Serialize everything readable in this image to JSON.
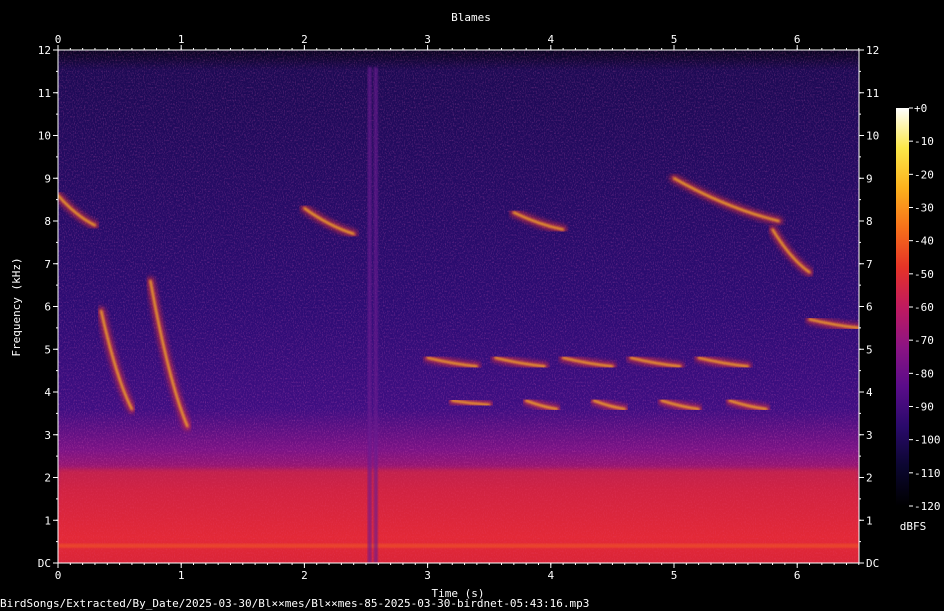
{
  "chart_data": {
    "type": "heatmap",
    "title": "Blames",
    "xlabel": "Time (s)",
    "ylabel": "Frequency (kHz)",
    "xlim": [
      0,
      6.5
    ],
    "ylim": [
      0,
      12
    ],
    "x_ticks": [
      "0",
      "1",
      "2",
      "3",
      "4",
      "5",
      "6"
    ],
    "y_ticks": [
      "DC",
      "1",
      "2",
      "3",
      "4",
      "5",
      "6",
      "7",
      "8",
      "9",
      "10",
      "11",
      "12"
    ],
    "colorbar": {
      "unit": "dBFS",
      "range": [
        -120,
        0
      ],
      "ticks": [
        "+0",
        "-10",
        "-20",
        "-30",
        "-40",
        "-50",
        "-60",
        "-70",
        "-80",
        "-90",
        "-100",
        "-110",
        "-120"
      ]
    },
    "vertical_clicks_s": [
      2.53,
      2.58
    ],
    "noise_floor_band_khz": [
      0,
      2.2
    ],
    "calls": [
      {
        "name": "descending sweep",
        "t": [
          0.35,
          0.6
        ],
        "f": [
          5.9,
          3.6
        ]
      },
      {
        "name": "descending sweep",
        "t": [
          0.75,
          1.05
        ],
        "f": [
          6.6,
          3.2
        ]
      },
      {
        "name": "whistle",
        "t": [
          0.0,
          0.3
        ],
        "f": [
          8.6,
          7.9
        ]
      },
      {
        "name": "slur",
        "t": [
          2.0,
          2.4
        ],
        "f": [
          8.3,
          7.7
        ]
      },
      {
        "name": "slur",
        "t": [
          3.7,
          4.1
        ],
        "f": [
          8.2,
          7.8
        ]
      },
      {
        "name": "repeated note",
        "t": [
          3.2,
          3.5
        ],
        "f": [
          3.8,
          3.7
        ]
      },
      {
        "name": "repeated note",
        "t": [
          3.8,
          4.05
        ],
        "f": [
          3.8,
          3.6
        ]
      },
      {
        "name": "repeated note",
        "t": [
          4.35,
          4.6
        ],
        "f": [
          3.8,
          3.6
        ]
      },
      {
        "name": "repeated note",
        "t": [
          4.9,
          5.2
        ],
        "f": [
          3.8,
          3.6
        ]
      },
      {
        "name": "repeated note",
        "t": [
          5.45,
          5.75
        ],
        "f": [
          3.8,
          3.6
        ]
      },
      {
        "name": "harmonic stack",
        "t": [
          3.0,
          3.4
        ],
        "f": [
          4.8,
          4.6
        ]
      },
      {
        "name": "harmonic stack",
        "t": [
          3.55,
          3.95
        ],
        "f": [
          4.8,
          4.6
        ]
      },
      {
        "name": "harmonic stack",
        "t": [
          4.1,
          4.5
        ],
        "f": [
          4.8,
          4.6
        ]
      },
      {
        "name": "harmonic stack",
        "t": [
          4.65,
          5.05
        ],
        "f": [
          4.8,
          4.6
        ]
      },
      {
        "name": "harmonic stack",
        "t": [
          5.2,
          5.6
        ],
        "f": [
          4.8,
          4.6
        ]
      },
      {
        "name": "descending whistle",
        "t": [
          5.0,
          5.85
        ],
        "f": [
          9.0,
          8.0
        ]
      },
      {
        "name": "descending whistle",
        "t": [
          5.8,
          6.1
        ],
        "f": [
          7.8,
          6.8
        ]
      },
      {
        "name": "trill",
        "t": [
          6.1,
          6.5
        ],
        "f": [
          5.7,
          5.5
        ]
      }
    ]
  },
  "footer": {
    "filepath": "BirdSongs/Extracted/By_Date/2025-03-30/Bl××mes/Bl××mes-85-2025-03-30-birdnet-05:43:16.mp3"
  },
  "colors": {
    "background": "#000000",
    "text": "#ffffff",
    "cmap": [
      "#000000",
      "#0b0630",
      "#2a0a6b",
      "#5a0c8a",
      "#8c1483",
      "#c01a5f",
      "#e53327",
      "#f7711a",
      "#fcb21d",
      "#fbe84a",
      "#ffffff"
    ]
  }
}
